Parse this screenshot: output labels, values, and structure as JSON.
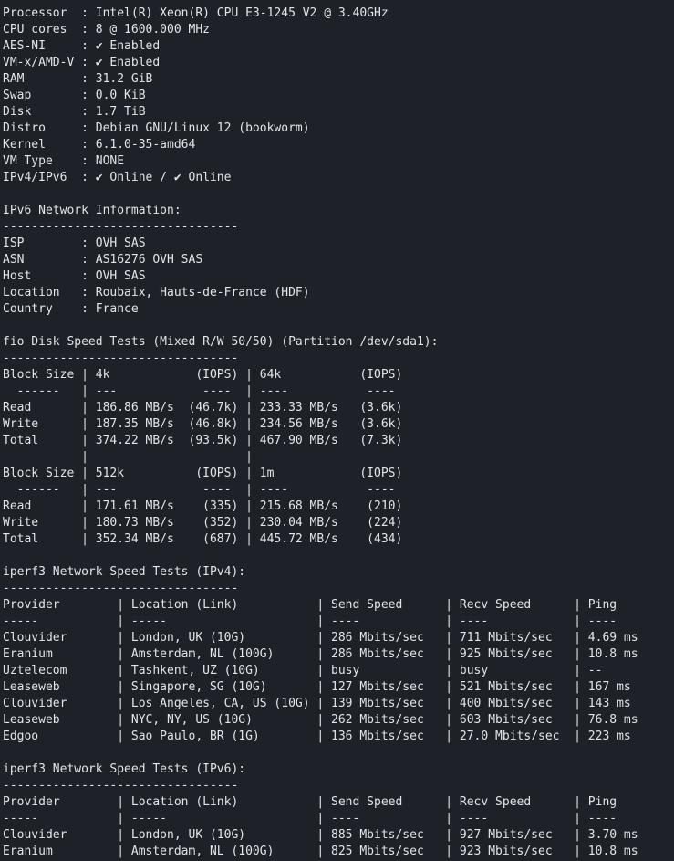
{
  "terminal": {
    "lines": [
      "Processor  : Intel(R) Xeon(R) CPU E3-1245 V2 @ 3.40GHz",
      "CPU cores  : 8 @ 1600.000 MHz",
      "AES-NI     : ✔ Enabled",
      "VM-x/AMD-V : ✔ Enabled",
      "RAM        : 31.2 GiB",
      "Swap       : 0.0 KiB",
      "Disk       : 1.7 TiB",
      "Distro     : Debian GNU/Linux 12 (bookworm)",
      "Kernel     : 6.1.0-35-amd64",
      "VM Type    : NONE",
      "IPv4/IPv6  : ✔ Online / ✔ Online",
      "",
      "IPv6 Network Information:",
      "---------------------------------",
      "ISP        : OVH SAS",
      "ASN        : AS16276 OVH SAS",
      "Host       : OVH SAS",
      "Location   : Roubaix, Hauts-de-France (HDF)",
      "Country    : France",
      "",
      "fio Disk Speed Tests (Mixed R/W 50/50) (Partition /dev/sda1):",
      "---------------------------------",
      "Block Size | 4k            (IOPS) | 64k           (IOPS)",
      "  ------   | ---            ----  | ----           ----",
      "Read       | 186.86 MB/s  (46.7k) | 233.33 MB/s   (3.6k)",
      "Write      | 187.35 MB/s  (46.8k) | 234.56 MB/s   (3.6k)",
      "Total      | 374.22 MB/s  (93.5k) | 467.90 MB/s   (7.3k)",
      "           |                      |",
      "Block Size | 512k          (IOPS) | 1m            (IOPS)",
      "  ------   | ---            ----  | ----           ----",
      "Read       | 171.61 MB/s    (335) | 215.68 MB/s    (210)",
      "Write      | 180.73 MB/s    (352) | 230.04 MB/s    (224)",
      "Total      | 352.34 MB/s    (687) | 445.72 MB/s    (434)",
      "",
      "iperf3 Network Speed Tests (IPv4):",
      "---------------------------------",
      "Provider        | Location (Link)           | Send Speed      | Recv Speed      | Ping",
      "-----           | -----                     | ----            | ----            | ----",
      "Clouvider       | London, UK (10G)          | 286 Mbits/sec   | 711 Mbits/sec   | 4.69 ms",
      "Eranium         | Amsterdam, NL (100G)      | 286 Mbits/sec   | 925 Mbits/sec   | 10.8 ms",
      "Uztelecom       | Tashkent, UZ (10G)        | busy            | busy            | --",
      "Leaseweb        | Singapore, SG (10G)       | 127 Mbits/sec   | 521 Mbits/sec   | 167 ms",
      "Clouvider       | Los Angeles, CA, US (10G) | 139 Mbits/sec   | 400 Mbits/sec   | 143 ms",
      "Leaseweb        | NYC, NY, US (10G)         | 262 Mbits/sec   | 603 Mbits/sec   | 76.8 ms",
      "Edgoo           | Sao Paulo, BR (1G)        | 136 Mbits/sec   | 27.0 Mbits/sec  | 223 ms",
      "",
      "iperf3 Network Speed Tests (IPv6):",
      "---------------------------------",
      "Provider        | Location (Link)           | Send Speed      | Recv Speed      | Ping",
      "-----           | -----                     | ----            | ----            | ----",
      "Clouvider       | London, UK (10G)          | 885 Mbits/sec   | 927 Mbits/sec   | 3.70 ms",
      "Eranium         | Amsterdam, NL (100G)      | 825 Mbits/sec   | 923 Mbits/sec   | 10.8 ms"
    ]
  }
}
